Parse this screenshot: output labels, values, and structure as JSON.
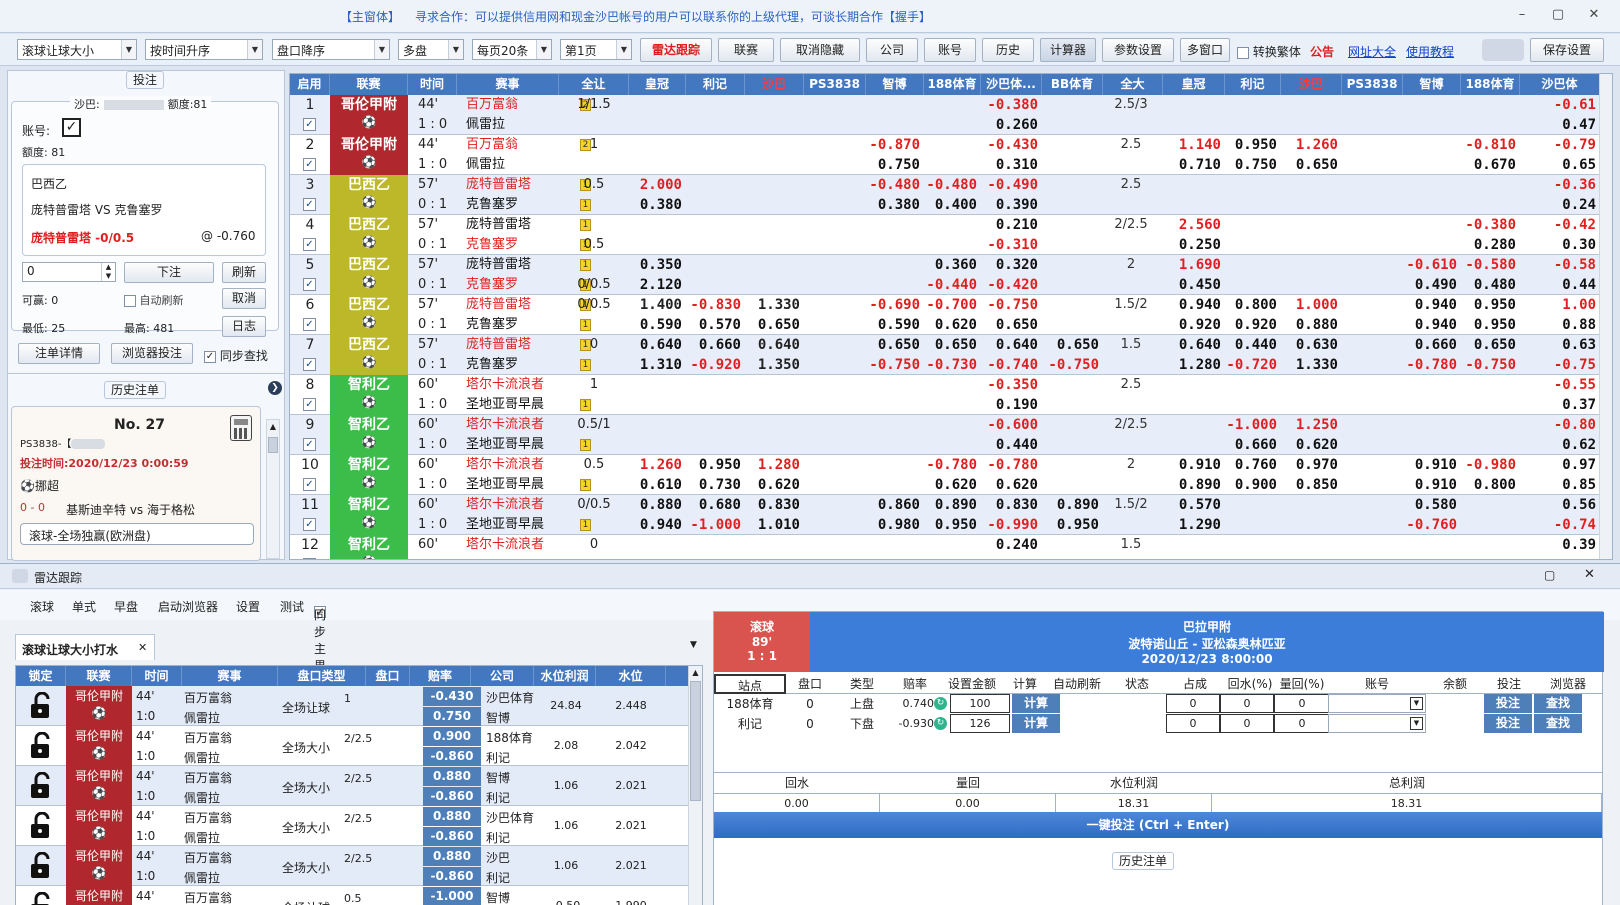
{
  "window": {
    "title": "【主窗体】",
    "notice": "寻求合作：可以提供信用网和现金沙巴帐号的用户可以联系你的上级代理，可谈长期合作【握手】",
    "minimize": "–",
    "restore": "▢",
    "close": "✕"
  },
  "toolbar": {
    "selects": [
      "滚球让球大小",
      "按时间升序",
      "盘口降序",
      "多盘",
      "每页20条",
      "第1页"
    ],
    "buttons": [
      "雷达跟踪",
      "联赛",
      "取消隐藏",
      "公司",
      "账号",
      "历史",
      "计算器",
      "参数设置",
      "多窗口"
    ],
    "convert_label": "转换繁体",
    "notice_label": "公告",
    "site_label": "网址大全",
    "tutorial_label": "使用教程",
    "save_label": "保存设置"
  },
  "left": {
    "bet_caption": "投注",
    "account_line": "沙巴:",
    "quota_label": "额度:81",
    "acct_label": "账号:",
    "quota2": "额度: 81",
    "league": "巴西乙",
    "match": "庞特普雷塔 VS 克鲁塞罗",
    "pick": "庞特普雷塔 -0/0.5",
    "odds": "@ -0.760",
    "amount": "0",
    "bet_btn": "下注",
    "refresh_btn": "刷新",
    "win_label": "可赢:  0",
    "auto_refresh": "自动刷新",
    "cancel_btn": "取消",
    "min_label": "最低:  25",
    "max_label": "最高: 481",
    "log_btn": "日志",
    "detail_btn": "注单详情",
    "browser_btn": "浏览器投注",
    "sync_label": "同步查找",
    "history_caption": "历史注单",
    "ticket_no": "No. 27",
    "ticket_site": "PS3838-【",
    "ticket_time": "投注时间:2020/12/23 0:00:59",
    "ticket_market": "挪超",
    "ticket_score": "0 - 0",
    "ticket_match": "基斯迪辛特 vs 海于格松",
    "ticket_bottom": "滚球-全场独赢(欧洲盘)"
  },
  "grid": {
    "headers": [
      "启用",
      "联赛",
      "时间",
      "赛事",
      "全让",
      "皇冠",
      "利记",
      "沙巴",
      "PS3838",
      "智博",
      "188体育",
      "沙巴体...",
      "BB体育",
      "全大",
      "皇冠",
      "利记",
      "沙巴",
      "PS3838",
      "智博",
      "188体育",
      "沙巴体"
    ],
    "rows": [
      {
        "n": "1",
        "league": "哥伦甲附",
        "lc": "#b0282d",
        "time": "44'",
        "score": "1 : 0",
        "home": "百万富翁",
        "away": "佩雷拉",
        "hred": true,
        "ared": false,
        "b1": "2",
        "b2": "",
        "hcp": "1/1.5",
        "hcp2": "",
        "v": [
          [
            "",
            "",
            "",
            "",
            "",
            "",
            "-0.380",
            "",
            "2.5/3",
            "",
            "",
            "",
            "",
            "",
            "",
            "-0.61"
          ],
          [
            "",
            "",
            "",
            "",
            "",
            "",
            "0.260",
            "",
            "",
            "",
            "",
            "",
            "",
            "",
            "",
            "0.47"
          ]
        ]
      },
      {
        "n": "2",
        "league": "哥伦甲附",
        "lc": "#b0282d",
        "time": "44'",
        "score": "1 : 0",
        "home": "百万富翁",
        "away": "佩雷拉",
        "hred": true,
        "ared": false,
        "b1": "2",
        "b2": "",
        "hcp": "1",
        "hcp2": "",
        "v": [
          [
            "",
            "",
            "",
            "",
            "-0.870",
            "",
            "-0.430",
            "",
            "2.5",
            "1.140",
            "0.950",
            "1.260",
            "",
            "",
            "-0.810",
            "-0.79"
          ],
          [
            "",
            "",
            "",
            "",
            "0.750",
            "",
            "0.310",
            "",
            "",
            "0.710",
            "0.750",
            "0.650",
            "",
            "",
            "0.670",
            "0.65"
          ]
        ]
      },
      {
        "n": "3",
        "league": "巴西乙",
        "lc": "#bcb82a",
        "time": "57'",
        "score": "0 : 1",
        "home": "庞特普雷塔",
        "away": "克鲁塞罗",
        "hred": true,
        "ared": false,
        "b1": "1",
        "b2": "1",
        "hcp": "0.5",
        "hcp2": "",
        "v": [
          [
            "2.000",
            "",
            "",
            "",
            "-0.480",
            "-0.480",
            "-0.490",
            "",
            "2.5",
            "",
            "",
            "",
            "",
            "",
            "",
            "-0.36"
          ],
          [
            "0.380",
            "",
            "",
            "",
            "0.380",
            "0.400",
            "0.390",
            "",
            "",
            "",
            "",
            "",
            "",
            "",
            "",
            "0.24"
          ]
        ]
      },
      {
        "n": "4",
        "league": "巴西乙",
        "lc": "#bcb82a",
        "time": "57'",
        "score": "0 : 1",
        "home": "庞特普雷塔",
        "away": "克鲁塞罗",
        "hred": false,
        "ared": true,
        "b1": "1",
        "b2": "1",
        "hcp": "",
        "hcp2": "0.5",
        "v": [
          [
            "",
            "",
            "",
            "",
            "",
            "",
            "0.210",
            "",
            "2/2.5",
            "2.560",
            "",
            "",
            "",
            "",
            "-0.380",
            "-0.42"
          ],
          [
            "",
            "",
            "",
            "",
            "",
            "",
            "-0.310",
            "",
            "",
            "0.250",
            "",
            "",
            "",
            "",
            "0.280",
            "0.30"
          ]
        ]
      },
      {
        "n": "5",
        "league": "巴西乙",
        "lc": "#bcb82a",
        "time": "57'",
        "score": "0 : 1",
        "home": "庞特普雷塔",
        "away": "克鲁塞罗",
        "hred": false,
        "ared": true,
        "b1": "1",
        "b2": "1",
        "hcp": "",
        "hcp2": "0/0.5",
        "v": [
          [
            "0.350",
            "",
            "",
            "",
            "",
            "0.360",
            "0.320",
            "",
            "2",
            "1.690",
            "",
            "",
            "",
            "-0.610",
            "-0.580",
            "-0.58"
          ],
          [
            "2.120",
            "",
            "",
            "",
            "",
            "-0.440",
            "-0.420",
            "",
            "",
            "0.450",
            "",
            "",
            "",
            "0.490",
            "0.480",
            "0.44"
          ]
        ]
      },
      {
        "n": "6",
        "league": "巴西乙",
        "lc": "#bcb82a",
        "time": "57'",
        "score": "0 : 1",
        "home": "庞特普雷塔",
        "away": "克鲁塞罗",
        "hred": true,
        "ared": false,
        "b1": "1",
        "b2": "1",
        "hcp": "0/0.5",
        "hcp2": "",
        "v": [
          [
            "1.400",
            "-0.830",
            "1.330",
            "",
            "-0.690",
            "-0.700",
            "-0.750",
            "",
            "1.5/2",
            "0.940",
            "0.800",
            "1.000",
            "",
            "0.940",
            "0.950",
            "1.00"
          ],
          [
            "0.590",
            "0.570",
            "0.650",
            "",
            "0.590",
            "0.620",
            "0.650",
            "",
            "",
            "0.920",
            "0.920",
            "0.880",
            "",
            "0.940",
            "0.950",
            "0.88"
          ]
        ]
      },
      {
        "n": "7",
        "league": "巴西乙",
        "lc": "#bcb82a",
        "time": "57'",
        "score": "0 : 1",
        "home": "庞特普雷塔",
        "away": "克鲁塞罗",
        "hred": true,
        "ared": false,
        "b1": "1",
        "b2": "1",
        "hcp": "0",
        "hcp2": "",
        "v": [
          [
            "0.640",
            "0.660",
            "0.640",
            "",
            "0.650",
            "0.650",
            "0.640",
            "0.650",
            "1.5",
            "0.640",
            "0.440",
            "0.630",
            "",
            "0.660",
            "0.650",
            "0.63"
          ],
          [
            "1.310",
            "-0.920",
            "1.350",
            "",
            "-0.750",
            "-0.730",
            "-0.740",
            "-0.750",
            "",
            "1.280",
            "-0.720",
            "1.330",
            "",
            "-0.780",
            "-0.750",
            "-0.75"
          ]
        ]
      },
      {
        "n": "8",
        "league": "智利乙",
        "lc": "#3cbd4a",
        "time": "60'",
        "score": "1 : 0",
        "home": "塔尔卡流浪者",
        "away": "圣地亚哥早晨",
        "hred": true,
        "ared": false,
        "b1": "",
        "b2": "1",
        "hcp": "1",
        "hcp2": "",
        "v": [
          [
            "",
            "",
            "",
            "",
            "",
            "",
            "-0.350",
            "",
            "2.5",
            "",
            "",
            "",
            "",
            "",
            "",
            "-0.55"
          ],
          [
            "",
            "",
            "",
            "",
            "",
            "",
            "0.190",
            "",
            "",
            "",
            "",
            "",
            "",
            "",
            "",
            "0.37"
          ]
        ]
      },
      {
        "n": "9",
        "league": "智利乙",
        "lc": "#3cbd4a",
        "time": "60'",
        "score": "1 : 0",
        "home": "塔尔卡流浪者",
        "away": "圣地亚哥早晨",
        "hred": true,
        "ared": false,
        "b1": "",
        "b2": "1",
        "hcp": "0.5/1",
        "hcp2": "",
        "v": [
          [
            "",
            "",
            "",
            "",
            "",
            "",
            "-0.600",
            "",
            "2/2.5",
            "",
            "-1.000",
            "1.250",
            "",
            "",
            "",
            "-0.80"
          ],
          [
            "",
            "",
            "",
            "",
            "",
            "",
            "0.440",
            "",
            "",
            "",
            "0.660",
            "0.620",
            "",
            "",
            "",
            "0.62"
          ]
        ]
      },
      {
        "n": "10",
        "league": "智利乙",
        "lc": "#3cbd4a",
        "time": "60'",
        "score": "1 : 0",
        "home": "塔尔卡流浪者",
        "away": "圣地亚哥早晨",
        "hred": true,
        "ared": false,
        "b1": "",
        "b2": "1",
        "hcp": "0.5",
        "hcp2": "",
        "v": [
          [
            "1.260",
            "0.950",
            "1.280",
            "",
            "",
            "-0.780",
            "-0.780",
            "",
            "2",
            "0.910",
            "0.760",
            "0.970",
            "",
            "0.910",
            "-0.980",
            "0.97"
          ],
          [
            "0.610",
            "0.730",
            "0.620",
            "",
            "",
            "0.620",
            "0.620",
            "",
            "",
            "0.890",
            "0.900",
            "0.850",
            "",
            "0.910",
            "0.800",
            "0.85"
          ]
        ]
      },
      {
        "n": "11",
        "league": "智利乙",
        "lc": "#3cbd4a",
        "time": "60'",
        "score": "1 : 0",
        "home": "塔尔卡流浪者",
        "away": "圣地亚哥早晨",
        "hred": true,
        "ared": false,
        "b1": "",
        "b2": "1",
        "hcp": "0/0.5",
        "hcp2": "",
        "v": [
          [
            "0.880",
            "0.680",
            "0.830",
            "",
            "0.860",
            "0.890",
            "0.830",
            "0.890",
            "1.5/2",
            "0.570",
            "",
            "",
            "",
            "0.580",
            "",
            "0.56"
          ],
          [
            "0.940",
            "-1.000",
            "1.010",
            "",
            "0.980",
            "0.950",
            "-0.990",
            "0.950",
            "",
            "1.290",
            "",
            "",
            "",
            "-0.760",
            "",
            "-0.74"
          ]
        ]
      },
      {
        "n": "12",
        "league": "智利乙",
        "lc": "#3cbd4a",
        "time": "60'",
        "score": "",
        "home": "塔尔卡流浪者",
        "away": "",
        "hred": true,
        "ared": false,
        "b1": "",
        "b2": "",
        "hcp": "0",
        "hcp2": "",
        "v": [
          [
            "",
            "",
            "",
            "",
            "",
            "",
            "0.240",
            "",
            "1.5",
            "",
            "",
            "",
            "",
            "",
            "",
            "0.39"
          ],
          [
            "",
            "",
            "",
            "",
            "",
            "",
            "",
            "",
            "",
            "",
            "",
            "",
            "",
            "",
            "",
            ""
          ]
        ]
      }
    ]
  },
  "radar": {
    "title": "雷达跟踪",
    "menu": [
      "滚球",
      "单式",
      "早盘",
      "启动浏览器",
      "设置",
      "测试"
    ],
    "sync": "同步主界面过滤",
    "tab": "滚球让球大小打水",
    "headers": [
      "锁定",
      "联赛",
      "时间",
      "赛事",
      "盘口类型",
      "盘口",
      "赔率",
      "公司",
      "水位利润",
      "水位"
    ],
    "rows": [
      {
        "league": "哥伦甲附",
        "t1": "44'",
        "t2": "1:0",
        "h": "百万富翁",
        "a": "佩雷拉",
        "type": "全场让球",
        "line": "1",
        "o1": "-0.430",
        "o2": "0.750",
        "c1": "沙巴体育",
        "c2": "智博",
        "profit": "24.84",
        "water": "2.448"
      },
      {
        "league": "哥伦甲附",
        "t1": "44'",
        "t2": "1:0",
        "h": "百万富翁",
        "a": "佩雷拉",
        "type": "全场大小",
        "line": "2/2.5",
        "o1": "0.900",
        "o2": "-0.860",
        "c1": "188体育",
        "c2": "利记",
        "profit": "2.08",
        "water": "2.042"
      },
      {
        "league": "哥伦甲附",
        "t1": "44'",
        "t2": "1:0",
        "h": "百万富翁",
        "a": "佩雷拉",
        "type": "全场大小",
        "line": "2/2.5",
        "o1": "0.880",
        "o2": "-0.860",
        "c1": "智博",
        "c2": "利记",
        "profit": "1.06",
        "water": "2.021"
      },
      {
        "league": "哥伦甲附",
        "t1": "44'",
        "t2": "1:0",
        "h": "百万富翁",
        "a": "佩雷拉",
        "type": "全场大小",
        "line": "2/2.5",
        "o1": "0.880",
        "o2": "-0.860",
        "c1": "沙巴体育",
        "c2": "利记",
        "profit": "1.06",
        "water": "2.021"
      },
      {
        "league": "哥伦甲附",
        "t1": "44'",
        "t2": "1:0",
        "h": "百万富翁",
        "a": "佩雷拉",
        "type": "全场大小",
        "line": "2/2.5",
        "o1": "0.880",
        "o2": "-0.860",
        "c1": "沙巴",
        "c2": "利记",
        "profit": "1.06",
        "water": "2.021"
      },
      {
        "league": "哥伦甲附",
        "t1": "44'",
        "t2": "",
        "h": "百万富翁",
        "a": "",
        "type": "全场让球",
        "line": "0.5",
        "o1": "-1.000",
        "o2": "",
        "c1": "智博",
        "c2": "",
        "profit": "-0.50",
        "water": "1.990"
      }
    ],
    "detail": {
      "status": "滚球",
      "minute": "89'",
      "score": "1 : 1",
      "league": "巴拉甲附",
      "match": "波特诺山丘 - 亚松森奥林匹亚",
      "datetime": "2020/12/23 8:00:00",
      "headers": [
        "站点",
        "盘口",
        "类型",
        "赔率",
        "设置金额",
        "计算",
        "自动刷新",
        "状态",
        "占成",
        "回水(%)",
        "量回(%)",
        "账号",
        "余额",
        "投注",
        "浏览器"
      ],
      "rows": [
        {
          "site": "188体育",
          "line": "0",
          "type": "上盘",
          "odds": "0.740",
          "amount": "100",
          "calc": "计算",
          "share": "0",
          "rebate": "0",
          "back": "0",
          "bet": "投注",
          "check": "查找"
        },
        {
          "site": "利记",
          "line": "0",
          "type": "下盘",
          "odds": "-0.930",
          "amount": "126",
          "calc": "计算",
          "share": "0",
          "rebate": "0",
          "back": "0",
          "bet": "投注",
          "check": "查找"
        }
      ],
      "sum_headers": [
        "回水",
        "量回",
        "水位利润",
        "总利润"
      ],
      "sums": [
        "0.00",
        "0.00",
        "18.31",
        "18.31"
      ],
      "onekey": "一键投注 (Ctrl + Enter)",
      "history": "历史注单"
    }
  }
}
